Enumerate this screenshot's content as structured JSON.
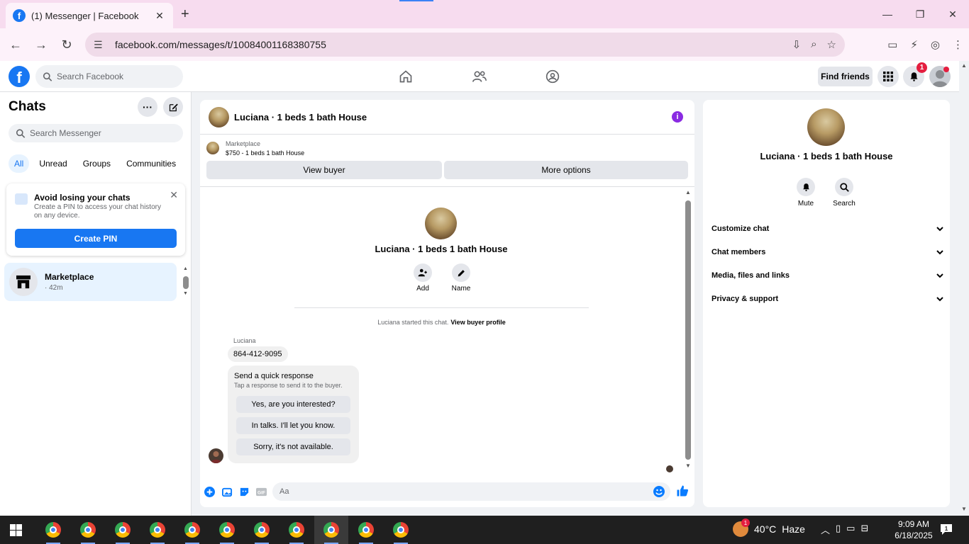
{
  "browser": {
    "tab_title": "(1) Messenger | Facebook",
    "url": "facebook.com/messages/t/10084001168380755",
    "new_tab_label": "+"
  },
  "fb_nav": {
    "search_placeholder": "Search Facebook",
    "find_friends": "Find friends",
    "notification_count": "1"
  },
  "chats": {
    "title": "Chats",
    "search_placeholder": "Search Messenger",
    "filters": [
      "All",
      "Unread",
      "Groups",
      "Communities"
    ],
    "active_filter": "All",
    "pin_card": {
      "title": "Avoid losing your chats",
      "description": "Create a PIN to access your chat history on any device.",
      "button": "Create PIN"
    },
    "items": [
      {
        "name": "Marketplace",
        "time": "· 42m"
      }
    ]
  },
  "conversation": {
    "title": "Luciana · 1 beds 1 bath House",
    "marketplace_label": "Marketplace",
    "listing": "$750 - 1 beds 1 bath House",
    "view_buyer": "View buyer",
    "more_options": "More options",
    "profile_name": "Luciana · 1 beds 1 bath House",
    "actions": [
      {
        "label": "Add",
        "icon": "add-person-icon"
      },
      {
        "label": "Name",
        "icon": "pencil-icon"
      }
    ],
    "started_text": "Luciana started this chat.",
    "view_buyer_profile": "View buyer profile",
    "sender": "Luciana",
    "phone_message": "864-412-9095",
    "quick_response": {
      "title": "Send a quick response",
      "subtitle": "Tap a response to send it to the buyer.",
      "options": [
        "Yes, are you interested?",
        "In talks. I'll let you know.",
        "Sorry, it's not available."
      ]
    },
    "composer_placeholder": "Aa"
  },
  "details": {
    "name": "Luciana · 1 beds 1 bath House",
    "actions": [
      {
        "label": "Mute",
        "icon": "bell-icon"
      },
      {
        "label": "Search",
        "icon": "search-icon"
      }
    ],
    "sections": [
      "Customize chat",
      "Chat members",
      "Media, files and links",
      "Privacy & support"
    ]
  },
  "taskbar": {
    "weather_temp": "40°C",
    "weather_desc": "Haze",
    "weather_badge": "1",
    "time": "9:09 AM",
    "date": "6/18/2025",
    "notifications": "1"
  },
  "colors": {
    "fb_blue": "#1877f2",
    "info_purple": "#8a2be2",
    "tab_bg": "#f7dcef",
    "taskbar_bg": "#1f1f1f"
  }
}
